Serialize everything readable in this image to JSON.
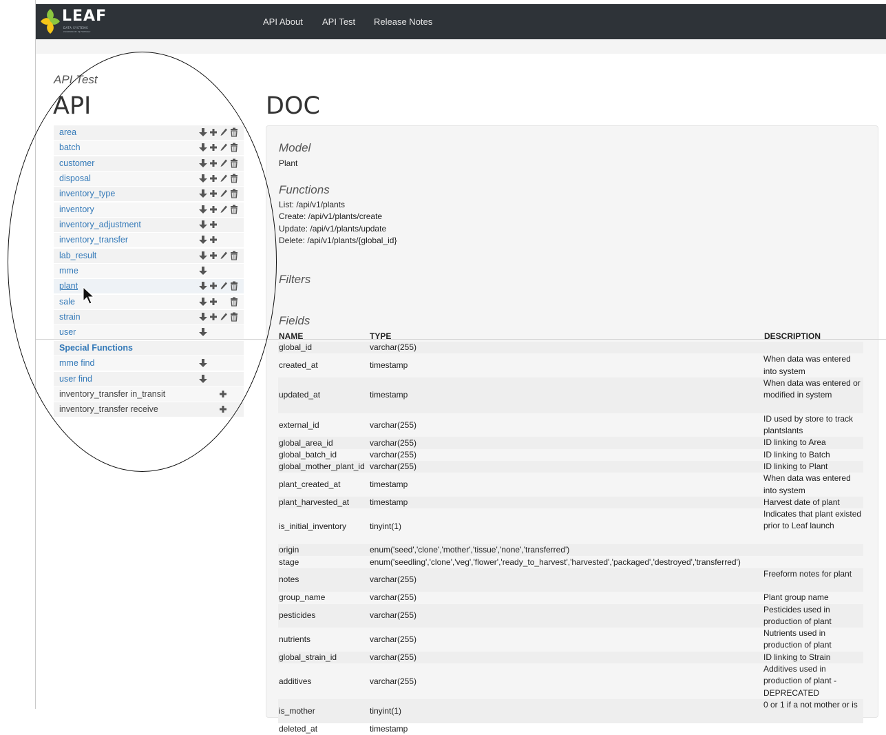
{
  "navbar": {
    "brand": "LEAF",
    "brand_sub": "DATA SYSTEMS",
    "brand_sub2": "POWERED BY MJ FREEWAY",
    "links": [
      "API About",
      "API Test",
      "Release Notes"
    ]
  },
  "page": {
    "breadcrumb": "API Test",
    "api_heading": "API",
    "doc_heading": "DOC"
  },
  "api_list": [
    {
      "label": "area",
      "actions": [
        "download",
        "add",
        "edit",
        "delete"
      ]
    },
    {
      "label": "batch",
      "actions": [
        "download",
        "add",
        "edit",
        "delete"
      ]
    },
    {
      "label": "customer",
      "actions": [
        "download",
        "add",
        "edit",
        "delete"
      ]
    },
    {
      "label": "disposal",
      "actions": [
        "download",
        "add",
        "edit",
        "delete"
      ]
    },
    {
      "label": "inventory_type",
      "actions": [
        "download",
        "add",
        "edit",
        "delete"
      ]
    },
    {
      "label": "inventory",
      "actions": [
        "download",
        "add",
        "edit",
        "delete"
      ]
    },
    {
      "label": "inventory_adjustment",
      "actions": [
        "download",
        "add"
      ]
    },
    {
      "label": "inventory_transfer",
      "actions": [
        "download",
        "add"
      ]
    },
    {
      "label": "lab_result",
      "actions": [
        "download",
        "add",
        "edit",
        "delete"
      ]
    },
    {
      "label": "mme",
      "actions": [
        "download"
      ]
    },
    {
      "label": "plant",
      "actions": [
        "download",
        "add",
        "edit",
        "delete"
      ]
    },
    {
      "label": "sale",
      "actions": [
        "download",
        "add",
        "",
        "delete"
      ]
    },
    {
      "label": "strain",
      "actions": [
        "download",
        "add",
        "edit",
        "delete"
      ]
    },
    {
      "label": "user",
      "actions": [
        "download"
      ]
    }
  ],
  "special": {
    "heading": "Special Functions",
    "items": [
      {
        "label": "mme find",
        "actions": [
          "download"
        ]
      },
      {
        "label": "user find",
        "actions": [
          "download"
        ]
      },
      {
        "label": "inventory_transfer in_transit",
        "actions": [
          "",
          "add"
        ]
      },
      {
        "label": "inventory_transfer receive",
        "actions": [
          "",
          "add"
        ]
      }
    ]
  },
  "doc": {
    "model_title": "Model",
    "model_value": "Plant",
    "functions_title": "Functions",
    "functions": [
      "List: /api/v1/plants",
      "Create: /api/v1/plants/create",
      "Update: /api/v1/plants/update",
      "Delete: /api/v1/plants/{global_id}"
    ],
    "filters_title": "Filters",
    "fields_title": "Fields",
    "columns": [
      "NAME",
      "TYPE",
      "DESCRIPTION"
    ],
    "fields": [
      {
        "name": "global_id",
        "type": "varchar(255)",
        "desc": ""
      },
      {
        "name": "created_at",
        "type": "timestamp",
        "desc": "When data was entered into system"
      },
      {
        "name": "updated_at",
        "type": "timestamp",
        "desc": "When data was entered or modified in system"
      },
      {
        "name": "external_id",
        "type": "varchar(255)",
        "desc": "ID used by store to track plantslants"
      },
      {
        "name": "global_area_id",
        "type": "varchar(255)",
        "desc": "ID linking to Area"
      },
      {
        "name": "global_batch_id",
        "type": "varchar(255)",
        "desc": "ID linking to Batch"
      },
      {
        "name": "global_mother_plant_id",
        "type": "varchar(255)",
        "desc": "ID linking to Plant"
      },
      {
        "name": "plant_created_at",
        "type": "timestamp",
        "desc": "When data was entered into system"
      },
      {
        "name": "plant_harvested_at",
        "type": "timestamp",
        "desc": "Harvest date of plant"
      },
      {
        "name": "is_initial_inventory",
        "type": "tinyint(1)",
        "desc": "Indicates that plant existed prior to Leaf launch"
      },
      {
        "name": "origin",
        "type": "enum('seed','clone','mother','tissue','none','transferred')",
        "desc": ""
      },
      {
        "name": "stage",
        "type": "enum('seedling','clone','veg','flower','ready_to_harvest','harvested','packaged','destroyed','transferred')",
        "desc": ""
      },
      {
        "name": "notes",
        "type": "varchar(255)",
        "desc": "Freeform notes for plant"
      },
      {
        "name": "group_name",
        "type": "varchar(255)",
        "desc": "Plant group name"
      },
      {
        "name": "pesticides",
        "type": "varchar(255)",
        "desc": "Pesticides used in production of plant"
      },
      {
        "name": "nutrients",
        "type": "varchar(255)",
        "desc": "Nutrients used in production of plant"
      },
      {
        "name": "global_strain_id",
        "type": "varchar(255)",
        "desc": "ID linking to Strain"
      },
      {
        "name": "additives",
        "type": "varchar(255)",
        "desc": "Additives used in production of plant - DEPRECATED"
      },
      {
        "name": "is_mother",
        "type": "tinyint(1)",
        "desc": "0 or 1 if a not mother or is"
      },
      {
        "name": "deleted_at",
        "type": "timestamp",
        "desc": ""
      }
    ]
  },
  "colors": {
    "navbar_bg": "#2e3338",
    "link_blue": "#3379b8",
    "logo_green": "#8cc63f",
    "logo_yellow": "#f5c518"
  }
}
